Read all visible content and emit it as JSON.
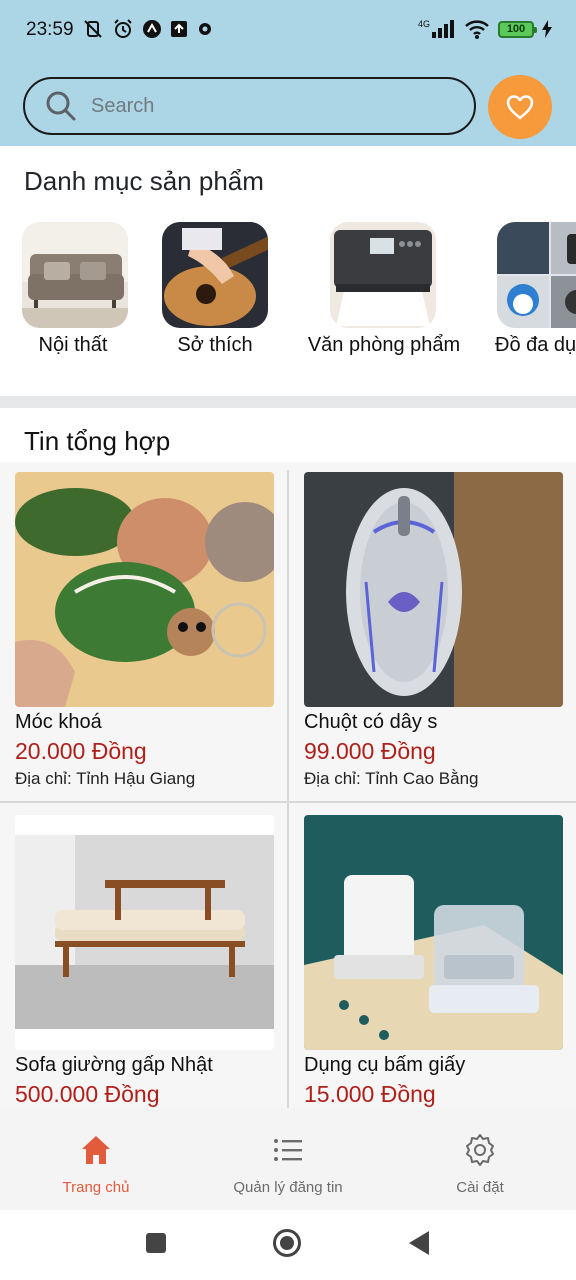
{
  "status_bar": {
    "time": "23:59",
    "network": "4G",
    "battery": "100"
  },
  "search": {
    "placeholder": "Search"
  },
  "categories": {
    "title": "Danh mục sản phẩm",
    "items": [
      {
        "label": "Nội thất"
      },
      {
        "label": "Sở thích"
      },
      {
        "label": "Văn phòng phẩm"
      },
      {
        "label": "Đồ đa dụng"
      }
    ]
  },
  "feed": {
    "title": "Tin tổng hợp",
    "items": [
      {
        "name": "Móc khoá",
        "price": "20.000 Đồng",
        "address": "Địa chỉ: Tỉnh Hậu Giang"
      },
      {
        "name": "Chuột có dây s",
        "price": "99.000 Đồng",
        "address": "Địa chỉ: Tỉnh Cao Bằng"
      },
      {
        "name": "Sofa giường gấp Nhật",
        "price": "500.000 Đồng",
        "address": ""
      },
      {
        "name": "Dụng cụ bấm giấy",
        "price": "15.000 Đồng",
        "address": ""
      }
    ]
  },
  "bottom_nav": {
    "items": [
      {
        "label": "Trang chủ",
        "icon": "home-icon",
        "active": true
      },
      {
        "label": "Quản lý đăng tin",
        "icon": "list-icon",
        "active": false
      },
      {
        "label": "Cài đặt",
        "icon": "gear-icon",
        "active": false
      }
    ]
  },
  "colors": {
    "header_bg": "#acd5e5",
    "accent_orange": "#f79a3c",
    "price_red": "#b0201a",
    "active_nav": "#e25b3c"
  }
}
